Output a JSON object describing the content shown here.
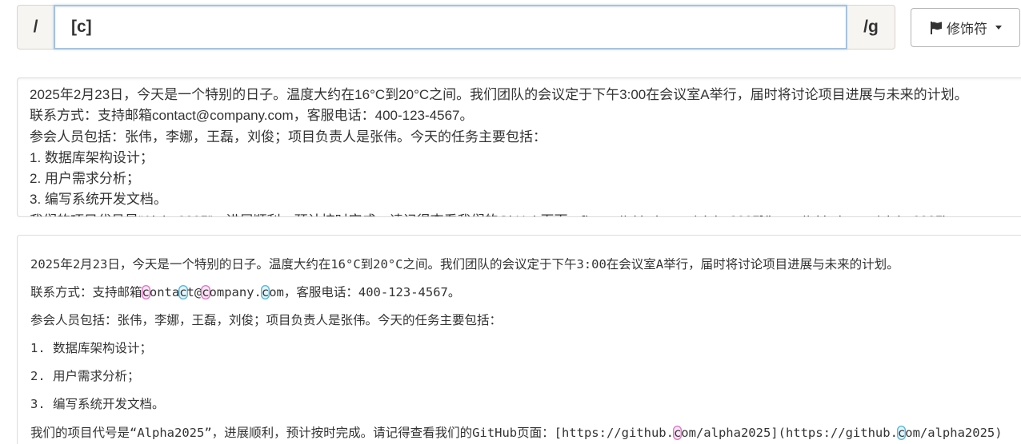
{
  "regex": {
    "open_delim": "/",
    "pattern": "[c]",
    "close_delim": "/g"
  },
  "modifier_button": {
    "label": "修饰符",
    "icon": "flag-icon"
  },
  "source_text": {
    "lines": [
      "2025年2月23日，今天是一个特别的日子。温度大约在16°C到20°C之间。我们团队的会议定于下午3:00在会议室A举行，届时将讨论项目进展与未来的计划。",
      "联系方式：支持邮箱contact@company.com，客服电话：400-123-4567。",
      "参会人员包括：张伟，李娜，王磊，刘俊；项目负责人是张伟。今天的任务主要包括：",
      "1. 数据库架构设计；",
      "2. 用户需求分析；",
      "3. 编写系统开发文档。",
      "我们的项目代号是“Alpha2025”，进展顺利，预计按时完成。请记得查看我们的GitHub页面：[https://github.com/alpha2025](https://github.com/alpha2025)"
    ]
  },
  "match_result": {
    "lines": [
      [
        {
          "t": "2025年2月23日，今天是一个特别的日子。温度大约在16°C到20°C之间。我们团队的会议定于下午3:00在会议室A举行，届时将讨论项目进展与未来的计划。"
        }
      ],
      [
        {
          "t": "联系方式：支持邮箱"
        },
        {
          "t": "c",
          "m": "pink"
        },
        {
          "t": "onta"
        },
        {
          "t": "c",
          "m": "blue"
        },
        {
          "t": "t@"
        },
        {
          "t": "c",
          "m": "pink"
        },
        {
          "t": "ompany."
        },
        {
          "t": "c",
          "m": "blue"
        },
        {
          "t": "om，客服电话：400-123-4567。"
        }
      ],
      [
        {
          "t": "参会人员包括：张伟，李娜，王磊，刘俊；项目负责人是张伟。今天的任务主要包括："
        }
      ],
      [
        {
          "t": "1. 数据库架构设计；"
        }
      ],
      [
        {
          "t": "2. 用户需求分析；"
        }
      ],
      [
        {
          "t": "3. 编写系统开发文档。"
        }
      ],
      [
        {
          "t": "我们的项目代号是“Alpha2025”，进展顺利，预计按时完成。请记得查看我们的GitHub页面：[https://github."
        },
        {
          "t": "c",
          "m": "pink"
        },
        {
          "t": "om/alpha2025](https://github."
        },
        {
          "t": "c",
          "m": "blue"
        },
        {
          "t": "om/alpha2025)"
        }
      ]
    ]
  },
  "colors": {
    "match_odd": "#e078c8",
    "match_even": "#55b9dd",
    "input_focus_border": "#a6c2df"
  }
}
